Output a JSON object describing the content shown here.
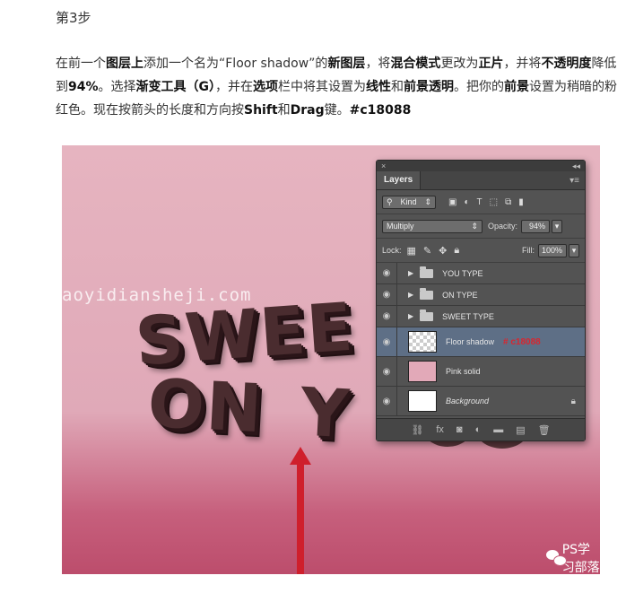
{
  "article": {
    "step_title": "第3步",
    "para": [
      {
        "t": "在前一个"
      },
      {
        "t": "图层上",
        "b": true
      },
      {
        "t": "添加一个名为“Floor shadow”的"
      },
      {
        "t": "新图层",
        "b": true
      },
      {
        "t": "，将"
      },
      {
        "t": "混合模式",
        "b": true
      },
      {
        "t": "更改为"
      },
      {
        "t": "正片",
        "b": true
      },
      {
        "t": "，并将"
      },
      {
        "t": "不透明度",
        "b": true
      },
      {
        "t": "降低到"
      },
      {
        "t": "94%",
        "b": true
      },
      {
        "t": "。选择"
      },
      {
        "t": "渐变工具（G）",
        "b": true
      },
      {
        "t": "，并在"
      },
      {
        "t": "选项",
        "b": true
      },
      {
        "t": "栏中将其设置为"
      },
      {
        "t": "线性",
        "b": true
      },
      {
        "t": "和"
      },
      {
        "t": "前景透明",
        "b": true
      },
      {
        "t": "。把你的"
      },
      {
        "t": "前景",
        "b": true
      },
      {
        "t": "设置为稍暗的粉红色。现在按箭头的长度和方向按"
      },
      {
        "t": "Shift",
        "b": true
      },
      {
        "t": "和"
      },
      {
        "t": "Drag",
        "b": true
      },
      {
        "t": "键。"
      },
      {
        "t": "#c18088",
        "b": true
      }
    ]
  },
  "canvas": {
    "watermark": "aoyidiansheji.com",
    "line1": "SWEE",
    "line2": "ON",
    "line3": "Y",
    "credit": "PS学习部落"
  },
  "layers_panel": {
    "collapse_glyph": "×",
    "expand_glyph": "◂◂",
    "tab": "Layers",
    "menu_glyph": "▾≡",
    "kind_label": "Kind",
    "kind_arrow": "⇕",
    "blend_mode": "Multiply",
    "blend_arrow": "⇕",
    "opacity_label": "Opacity:",
    "opacity_value": "94%",
    "lock_label": "Lock:",
    "fill_label": "Fill:",
    "fill_value": "100%",
    "dropdown_arrow": "▾",
    "layers": [
      {
        "name": "YOU TYPE",
        "type": "group"
      },
      {
        "name": "ON TYPE",
        "type": "group"
      },
      {
        "name": "SWEET TYPE",
        "type": "group"
      },
      {
        "name": "Floor shadow",
        "type": "layer",
        "selected": true,
        "annotation": "# c18088"
      },
      {
        "name": "Pink solid",
        "type": "layer"
      },
      {
        "name": "Background",
        "type": "background"
      }
    ],
    "colors": {
      "annotation": "#d8262f",
      "selected_row": "#5e6f86",
      "canvas_pink": "#e2a9b8"
    }
  }
}
